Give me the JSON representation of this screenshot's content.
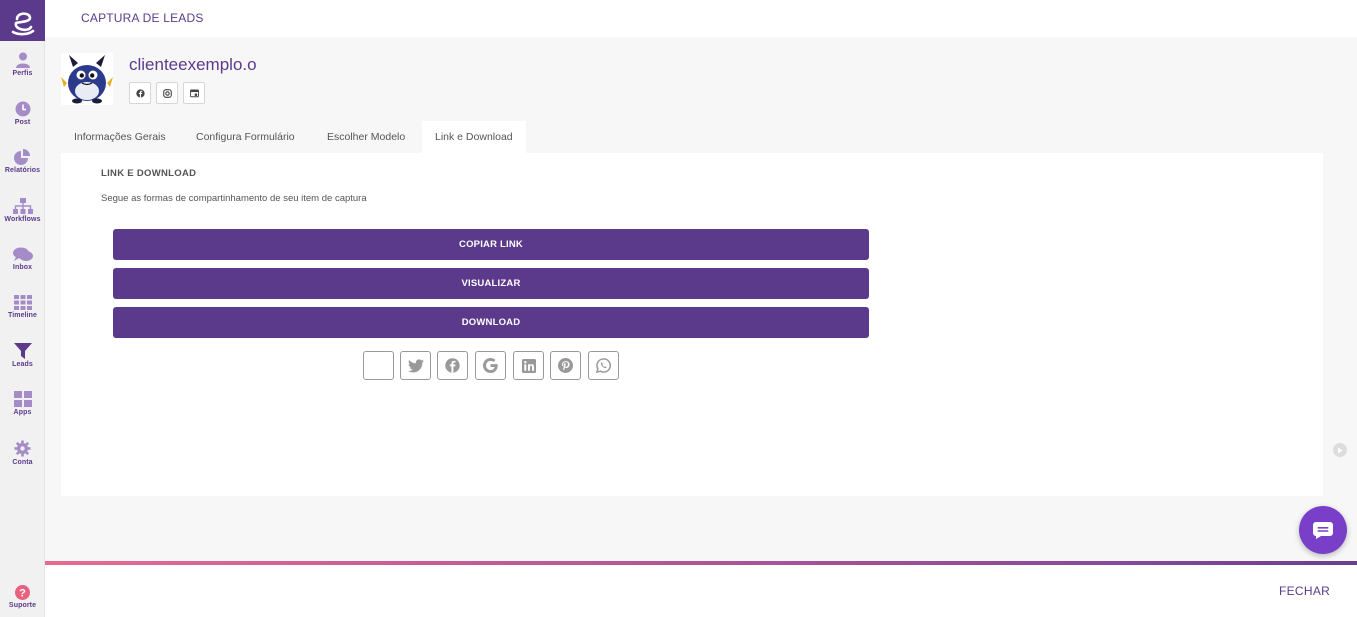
{
  "header": {
    "title": "CAPTURA DE LEADS"
  },
  "sidebar": {
    "items": [
      {
        "label": "Perfis",
        "icon": "user-icon"
      },
      {
        "label": "Post",
        "icon": "clock-icon"
      },
      {
        "label": "Relatórios",
        "icon": "pie-chart-icon"
      },
      {
        "label": "Workflows",
        "icon": "sitemap-icon"
      },
      {
        "label": "Inbox",
        "icon": "chat-icon"
      },
      {
        "label": "Timeline",
        "icon": "grid-icon"
      },
      {
        "label": "Leads",
        "icon": "filter-icon"
      },
      {
        "label": "Apps",
        "icon": "apps-icon"
      },
      {
        "label": "Conta",
        "icon": "gear-icon"
      }
    ],
    "support_label": "Suporte"
  },
  "profile": {
    "name": "clienteexemplo.o",
    "networks": [
      "facebook-icon",
      "instagram-icon",
      "google-business-icon"
    ]
  },
  "tabs": [
    {
      "label": "Informações Gerais",
      "active": false
    },
    {
      "label": "Configura Formulário",
      "active": false
    },
    {
      "label": "Escolher Modelo",
      "active": false
    },
    {
      "label": "Link e Download",
      "active": true
    }
  ],
  "content": {
    "title": "LINK E DOWNLOAD",
    "description": "Segue as formas de compartinhamento de seu item de captura",
    "buttons": {
      "copy": "COPIAR LINK",
      "view": "VISUALIZAR",
      "download": "DOWNLOAD"
    },
    "share_icons": [
      "blank-icon",
      "twitter-icon",
      "facebook-icon",
      "google-icon",
      "linkedin-icon",
      "pinterest-icon",
      "whatsapp-icon"
    ]
  },
  "footer": {
    "close_label": "FECHAR"
  },
  "colors": {
    "brand": "#5b3a8c",
    "chat": "#7a3fc8"
  }
}
